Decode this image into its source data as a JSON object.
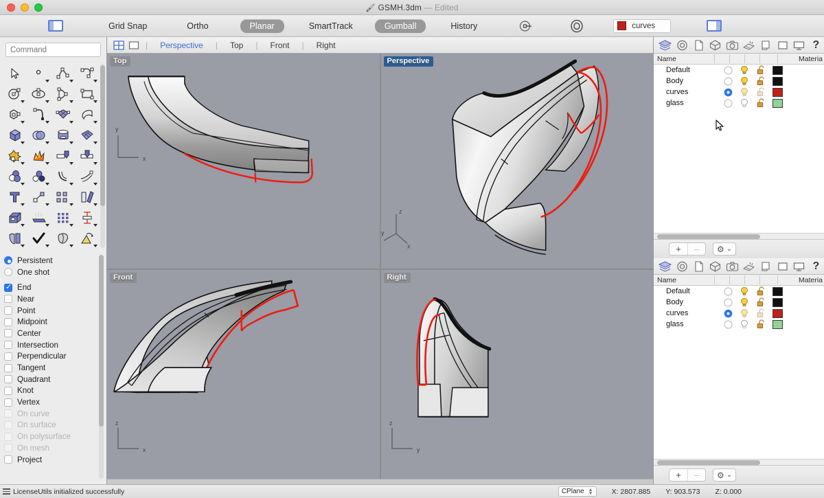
{
  "window": {
    "title": "GSMH.3dm",
    "title_separator": "—",
    "edit_state": "Edited",
    "app_icon": "rhino-icon",
    "traffic_lights": [
      "close",
      "minimize",
      "zoom"
    ]
  },
  "toolbar": {
    "left_panel_toggle": "left-panel-toggle",
    "right_panel_toggle": "right-panel-toggle",
    "items": [
      {
        "label": "Grid Snap",
        "active": false
      },
      {
        "label": "Ortho",
        "active": false
      },
      {
        "label": "Planar",
        "active": true
      },
      {
        "label": "SmartTrack",
        "active": false
      },
      {
        "label": "Gumball",
        "active": true
      },
      {
        "label": "History",
        "active": false
      }
    ],
    "record_history_icon": "record-history-icon",
    "osnap_icon": "osnap-target-icon",
    "current_layer": {
      "name": "curves",
      "color": "#c0211a"
    }
  },
  "command": {
    "placeholder": "Command",
    "value": ""
  },
  "tools": {
    "rows": [
      [
        "select-arrow",
        "point",
        "polyline",
        "curve-control-points"
      ],
      [
        "circle",
        "ellipse",
        "arc",
        "rectangle"
      ],
      [
        "polygon",
        "curve-fillet",
        "surface-from-points",
        "surface-patch"
      ],
      [
        "box",
        "sphere",
        "cylinder",
        "surface-mesh"
      ],
      [
        "boolean-union",
        "explode-surface",
        "extrude-curve",
        "extrude-surface"
      ],
      [
        "boolean-difference",
        "boolean-intersection",
        "offset-curve",
        "offset-surface"
      ],
      [
        "text-tool",
        "connect-points",
        "array-objects",
        "mirror-object"
      ],
      [
        "solid-shape",
        "render-lights",
        "grid-array",
        "dimension"
      ],
      [
        "trim-surface",
        "check-object",
        "cap-holes",
        "render-mesh"
      ]
    ]
  },
  "osnap": {
    "mode_options": [
      {
        "label": "Persistent",
        "selected": true
      },
      {
        "label": "One shot",
        "selected": false
      }
    ],
    "snaps": [
      {
        "label": "End",
        "checked": true,
        "disabled": false
      },
      {
        "label": "Near",
        "checked": false,
        "disabled": false
      },
      {
        "label": "Point",
        "checked": false,
        "disabled": false
      },
      {
        "label": "Midpoint",
        "checked": false,
        "disabled": false
      },
      {
        "label": "Center",
        "checked": false,
        "disabled": false
      },
      {
        "label": "Intersection",
        "checked": false,
        "disabled": false
      },
      {
        "label": "Perpendicular",
        "checked": false,
        "disabled": false
      },
      {
        "label": "Tangent",
        "checked": false,
        "disabled": false
      },
      {
        "label": "Quadrant",
        "checked": false,
        "disabled": false
      },
      {
        "label": "Knot",
        "checked": false,
        "disabled": false
      },
      {
        "label": "Vertex",
        "checked": false,
        "disabled": false
      },
      {
        "label": "On curve",
        "checked": false,
        "disabled": true
      },
      {
        "label": "On surface",
        "checked": false,
        "disabled": true
      },
      {
        "label": "On polysurface",
        "checked": false,
        "disabled": true
      },
      {
        "label": "On mesh",
        "checked": false,
        "disabled": true
      },
      {
        "label": "Project",
        "checked": false,
        "disabled": false
      }
    ]
  },
  "viewport_tabs": {
    "layout_4view_icon": "four-view-layout-icon",
    "layout_1view_icon": "single-view-layout-icon",
    "tabs": [
      {
        "label": "Perspective",
        "active": true
      },
      {
        "label": "Top",
        "active": false
      },
      {
        "label": "Front",
        "active": false
      },
      {
        "label": "Right",
        "active": false
      }
    ]
  },
  "viewports": [
    {
      "label": "Top",
      "active": false,
      "axes": [
        "y",
        "x"
      ]
    },
    {
      "label": "Perspective",
      "active": true,
      "axes": [
        "z",
        "x",
        "y"
      ]
    },
    {
      "label": "Front",
      "active": false,
      "axes": [
        "z",
        "x"
      ]
    },
    {
      "label": "Right",
      "active": false,
      "axes": [
        "z",
        "y"
      ]
    }
  ],
  "model": {
    "description": "shoe-heel-sole-surface-model",
    "surface_color_light": "#f2f2f2",
    "surface_color_dark": "#8f8f8f",
    "curve_color": "#ee1c10",
    "edge_color": "#111111",
    "background": "#9a9ca6"
  },
  "panels": {
    "icons": [
      "layers-icon",
      "properties-icon",
      "document-icon",
      "object-icon",
      "camera-icon",
      "render-icon",
      "notes-icon",
      "display-icon",
      "monitor-icon",
      "help-icon"
    ],
    "active_icon": "layers-icon",
    "columns": [
      "Name",
      "Materia"
    ],
    "layers": [
      {
        "name": "Default",
        "current": false,
        "light_on": true,
        "locked": false,
        "color": "#111111"
      },
      {
        "name": "Body",
        "current": false,
        "light_on": true,
        "locked": false,
        "color": "#111111"
      },
      {
        "name": "curves",
        "current": true,
        "light_on": true,
        "locked": false,
        "color": "#c0211a"
      },
      {
        "name": "glass",
        "current": false,
        "light_on": false,
        "locked": false,
        "color": "#90d394"
      }
    ],
    "footer": {
      "add_label": "+",
      "remove_label": "–",
      "gear_label": "⚙",
      "chevron_label": "⌄"
    }
  },
  "statusbar": {
    "menu_icon": "hamburger-icon",
    "message": "LicenseUtils initialized successfully",
    "cplane_label": "CPlane",
    "coords": [
      {
        "label": "X:",
        "value": "2807.885"
      },
      {
        "label": "Y:",
        "value": "903.573"
      },
      {
        "label": "Z:",
        "value": "0.000"
      }
    ]
  }
}
